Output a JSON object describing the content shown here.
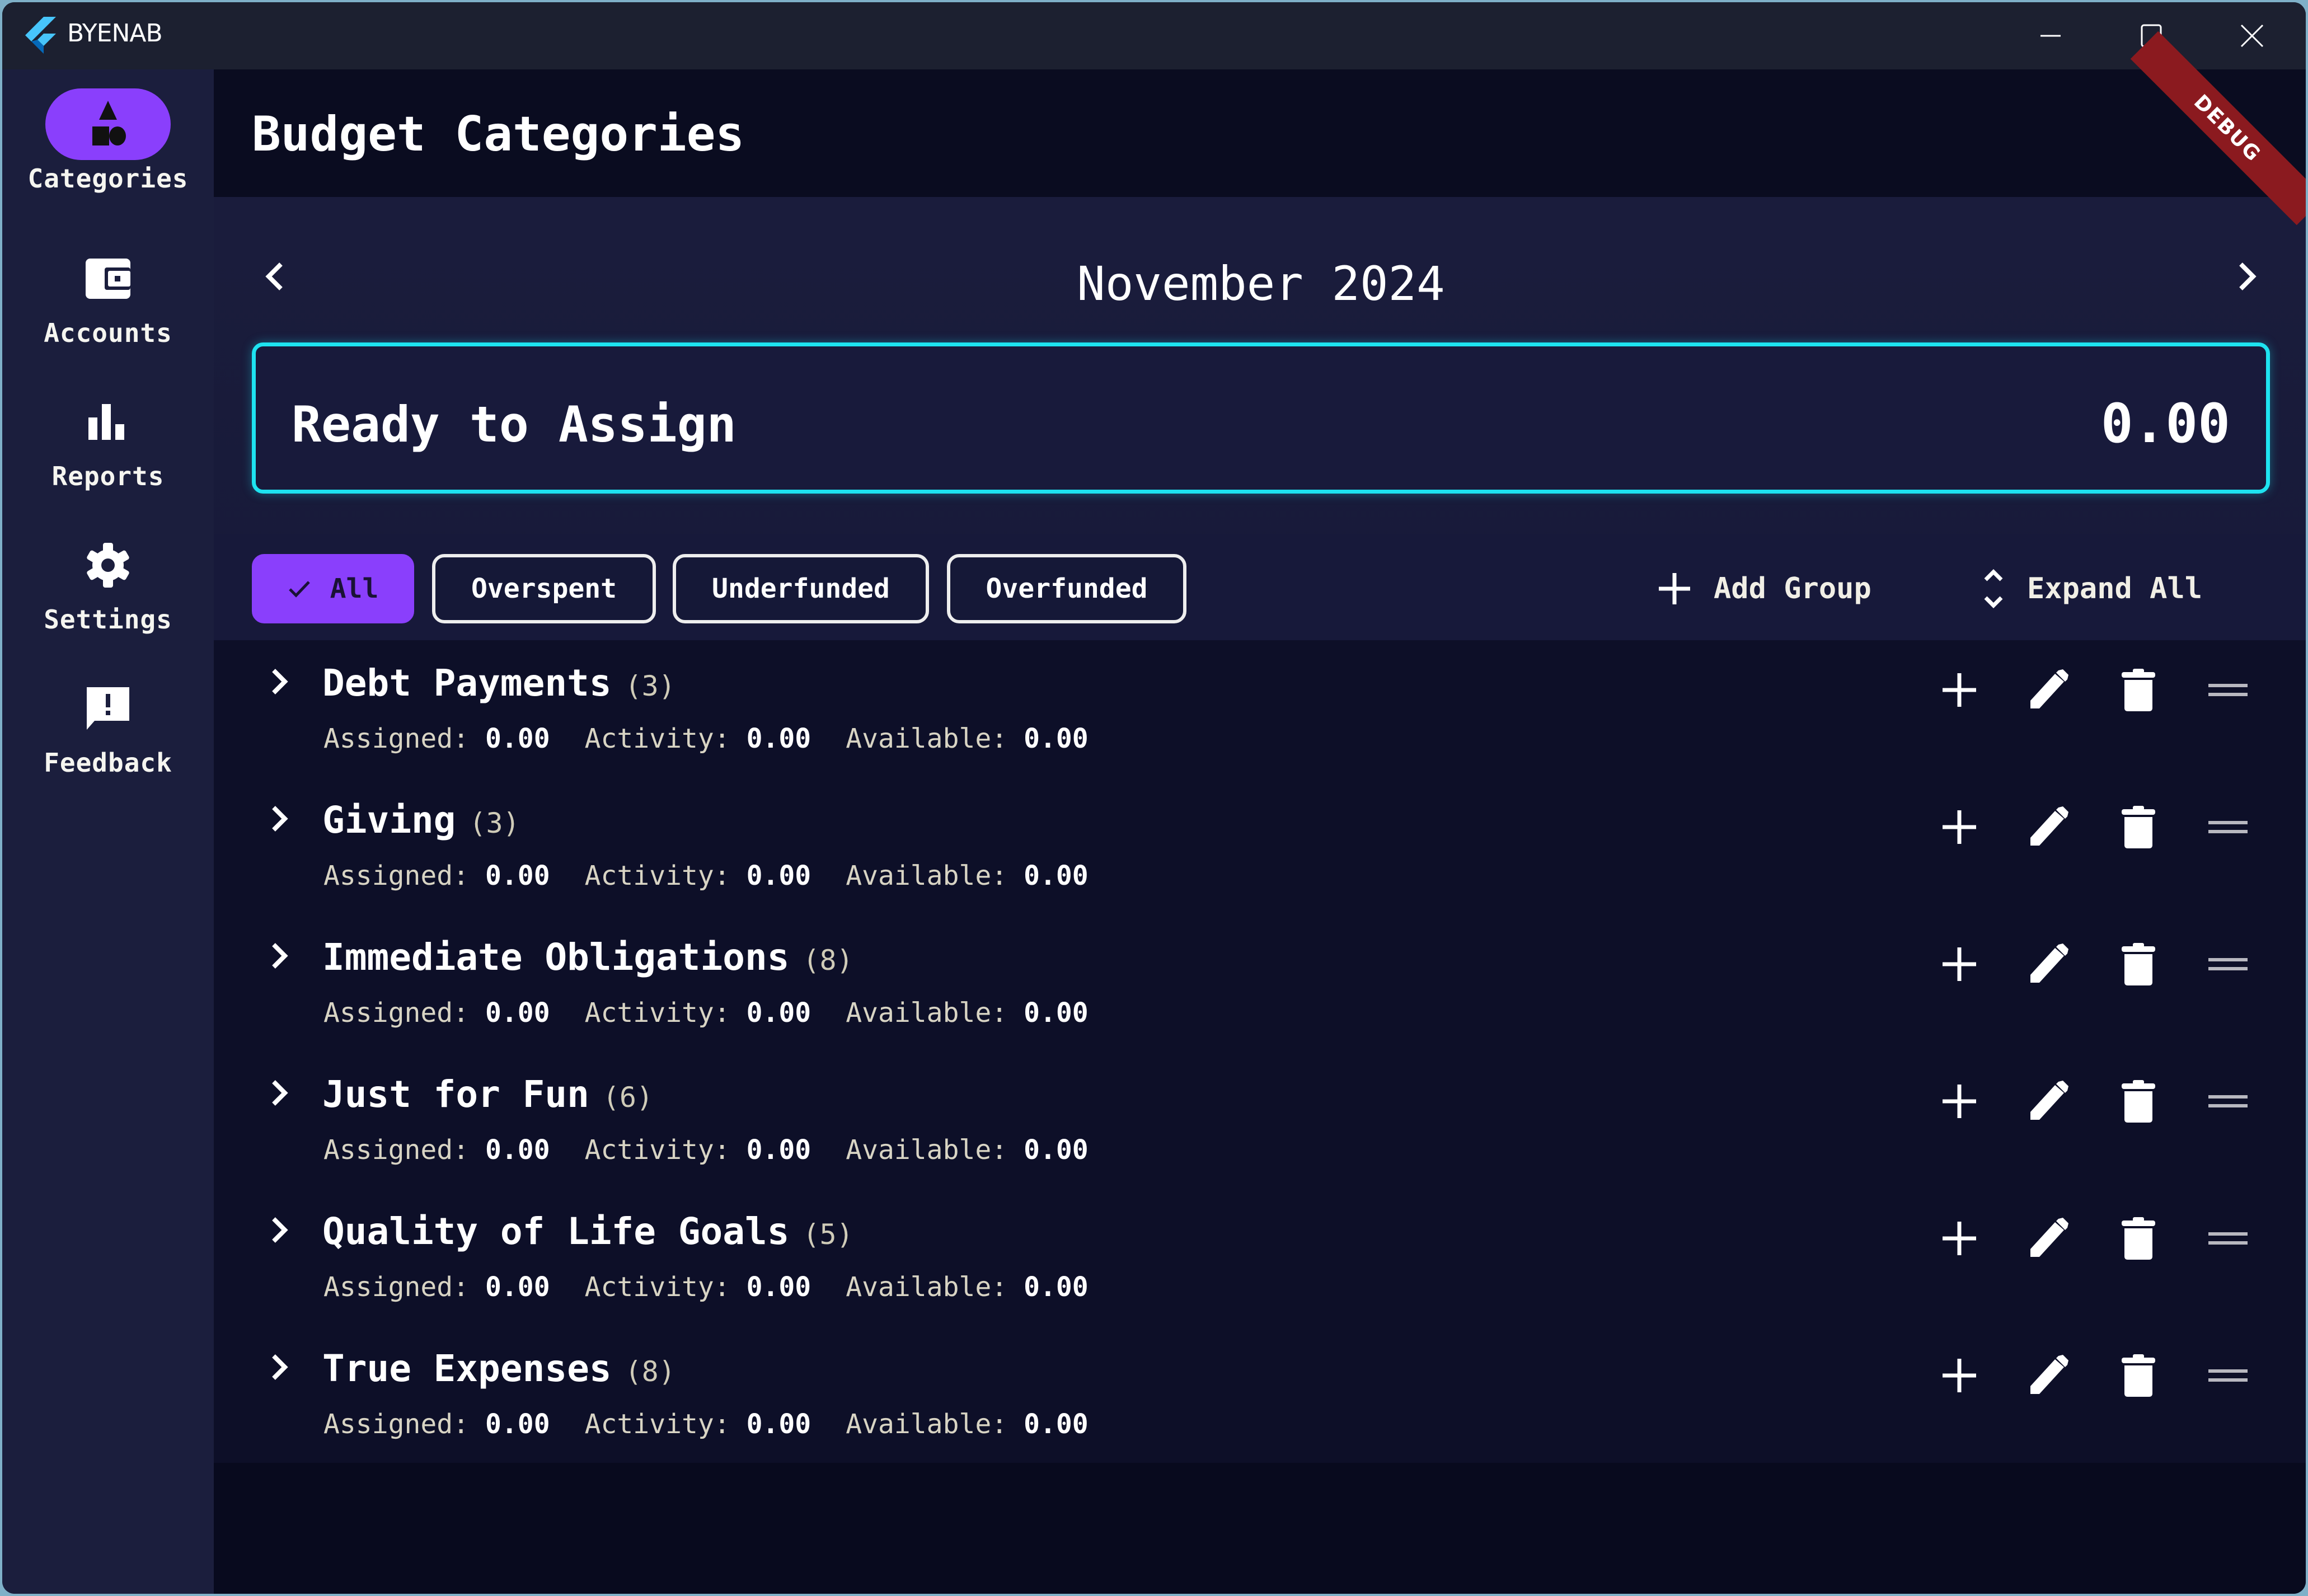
{
  "window": {
    "app_title": "BYENAB",
    "controls": {
      "minimize": "minimize-icon",
      "maximize": "maximize-icon",
      "close": "close-icon"
    },
    "debug_banner": "DEBUG"
  },
  "sidebar": {
    "items": [
      {
        "label": "Categories",
        "icon": "shapes-icon",
        "active": true
      },
      {
        "label": "Accounts",
        "icon": "wallet-icon",
        "active": false
      },
      {
        "label": "Reports",
        "icon": "bar-chart-icon",
        "active": false
      },
      {
        "label": "Settings",
        "icon": "gear-icon",
        "active": false
      },
      {
        "label": "Feedback",
        "icon": "feedback-icon",
        "active": false
      }
    ]
  },
  "header": {
    "title": "Budget Categories"
  },
  "month": {
    "label": "November 2024",
    "prev_icon": "chevron-left-icon",
    "next_icon": "chevron-right-icon"
  },
  "ready_to_assign": {
    "label": "Ready to Assign",
    "value": "0.00"
  },
  "filters": {
    "chips": [
      {
        "label": "All",
        "selected": true
      },
      {
        "label": "Overspent",
        "selected": false
      },
      {
        "label": "Underfunded",
        "selected": false
      },
      {
        "label": "Overfunded",
        "selected": false
      }
    ],
    "add_group_label": "Add Group",
    "expand_all_label": "Expand All"
  },
  "stat_labels": {
    "assigned": "Assigned:",
    "activity": "Activity:",
    "available": "Available:"
  },
  "groups": [
    {
      "name": "Debt Payments",
      "count": "(3)",
      "assigned": "0.00",
      "activity": "0.00",
      "available": "0.00"
    },
    {
      "name": "Giving",
      "count": "(3)",
      "assigned": "0.00",
      "activity": "0.00",
      "available": "0.00"
    },
    {
      "name": "Immediate Obligations",
      "count": "(8)",
      "assigned": "0.00",
      "activity": "0.00",
      "available": "0.00"
    },
    {
      "name": "Just for Fun",
      "count": "(6)",
      "assigned": "0.00",
      "activity": "0.00",
      "available": "0.00"
    },
    {
      "name": "Quality of Life Goals",
      "count": "(5)",
      "assigned": "0.00",
      "activity": "0.00",
      "available": "0.00"
    },
    {
      "name": "True Expenses",
      "count": "(8)",
      "assigned": "0.00",
      "activity": "0.00",
      "available": "0.00"
    }
  ],
  "colors": {
    "accent": "#8a3ffc",
    "highlight_border": "#1ee3f0",
    "debug": "#8b1a1f"
  }
}
